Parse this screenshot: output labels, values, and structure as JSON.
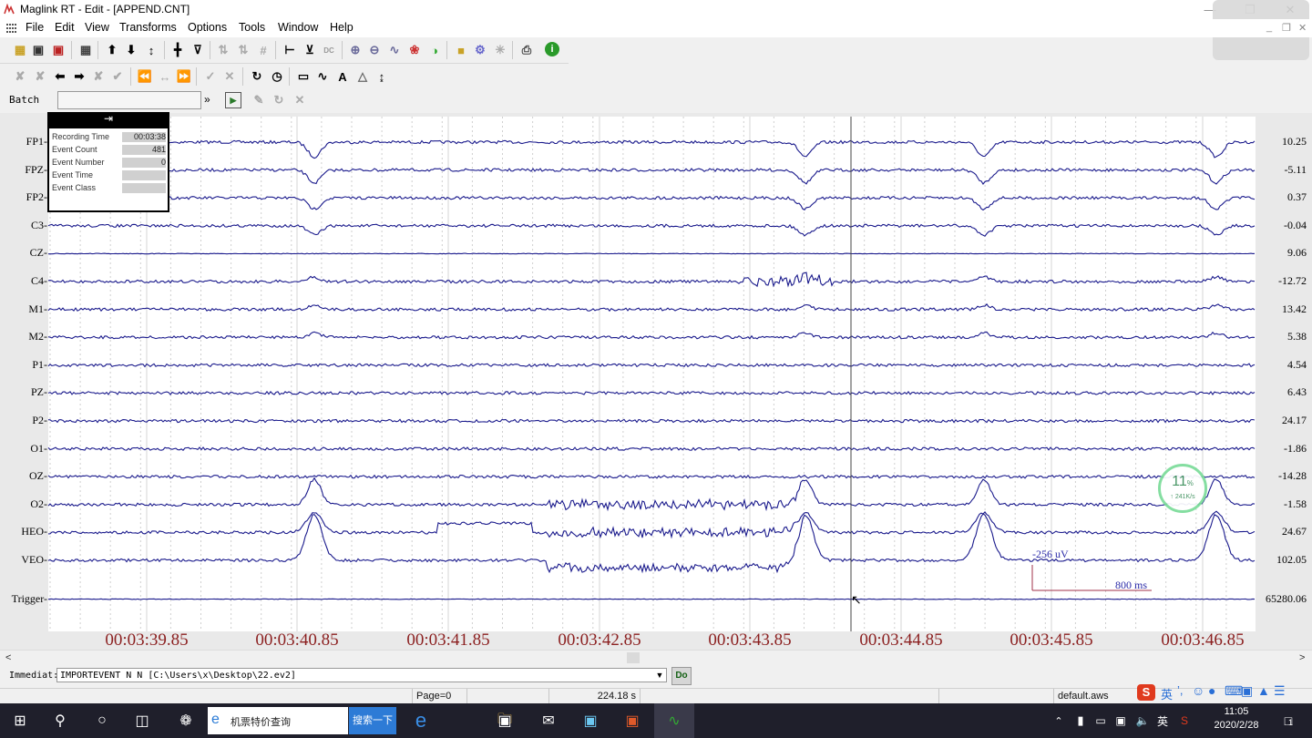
{
  "window": {
    "title": "Maglink RT - Edit - [APPEND.CNT]"
  },
  "menu": [
    "File",
    "Edit",
    "View",
    "Transforms",
    "Options",
    "Tools",
    "Window",
    "Help"
  ],
  "batch": {
    "label": "Batch",
    "value": ""
  },
  "info_panel": {
    "pin_glyph": "⇥",
    "rows": [
      {
        "label": "Recording Time",
        "value": "00:03:38"
      },
      {
        "label": "Event Count",
        "value": "481"
      },
      {
        "label": "Event Number",
        "value": "0"
      },
      {
        "label": "Event Time",
        "value": ""
      },
      {
        "label": "Event Class",
        "value": ""
      }
    ]
  },
  "channels": [
    {
      "name": "FP1",
      "scale": "10.25"
    },
    {
      "name": "FPZ",
      "scale": "-5.11"
    },
    {
      "name": "FP2",
      "scale": "0.37"
    },
    {
      "name": "C3",
      "scale": "-0.04"
    },
    {
      "name": "CZ",
      "scale": "9.06"
    },
    {
      "name": "C4",
      "scale": "-12.72"
    },
    {
      "name": "M1",
      "scale": "13.42"
    },
    {
      "name": "M2",
      "scale": "5.38"
    },
    {
      "name": "P1",
      "scale": "4.54"
    },
    {
      "name": "PZ",
      "scale": "6.43"
    },
    {
      "name": "P2",
      "scale": "24.17"
    },
    {
      "name": "O1",
      "scale": "-1.86"
    },
    {
      "name": "OZ",
      "scale": "-14.28"
    },
    {
      "name": "O2",
      "scale": "-1.58"
    },
    {
      "name": "HEO",
      "scale": "24.67"
    },
    {
      "name": "VEO",
      "scale": "102.05"
    },
    {
      "name": "Trigger",
      "scale": "65280.06"
    }
  ],
  "time_labels": [
    "00:03:39.85",
    "00:03:40.85",
    "00:03:41.85",
    "00:03:42.85",
    "00:03:43.85",
    "00:03:44.85",
    "00:03:45.85",
    "00:03:46.85"
  ],
  "scale_bar": {
    "amplitude": "-256 uV",
    "duration": "800 ms"
  },
  "immediate": {
    "label": "Immediat:",
    "command": "IMPORTEVENT N N [C:\\Users\\x\\Desktop\\22.ev2]",
    "do_label": "Do"
  },
  "status": {
    "page": "Page=0",
    "time": "224.18 s",
    "file": "default.aws"
  },
  "perf": {
    "percent": "11",
    "percent_unit": "%",
    "rate": "↑ 241K/s"
  },
  "taskbar": {
    "search_text": "机票特价查询",
    "search_button": "搜索一下",
    "clock_time": "11:05",
    "clock_date": "2020/2/28",
    "ime": "英",
    "notification_count": "1"
  },
  "colors": {
    "trace": "#1a1a8c",
    "time_label": "#8b1f1f",
    "scale_bar": "#a0304a",
    "taskbar": "#1f1f2b"
  }
}
